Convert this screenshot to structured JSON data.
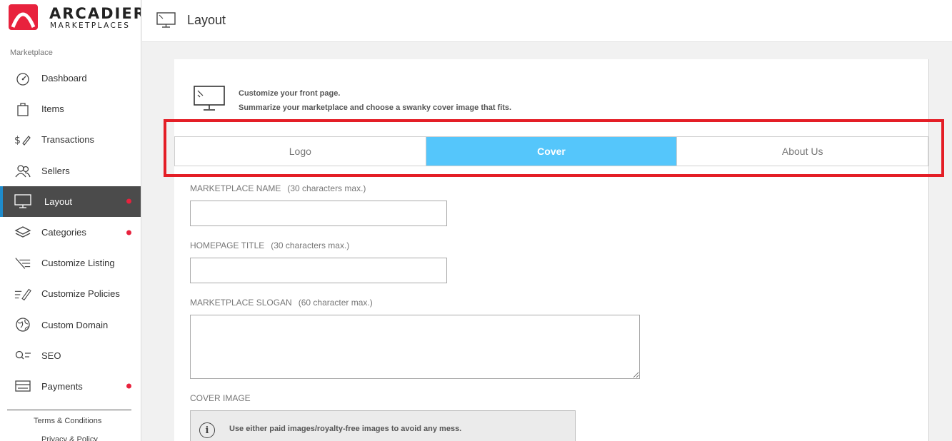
{
  "brand": {
    "name": "ARCADIER",
    "sub": "MARKETPLACES",
    "accent": "#e8223d"
  },
  "sidebar": {
    "section_label": "Marketplace",
    "items": [
      {
        "label": "Dashboard",
        "icon": "dashboard-icon",
        "active": false,
        "dot": false
      },
      {
        "label": "Items",
        "icon": "items-bag-icon",
        "active": false,
        "dot": false
      },
      {
        "label": "Transactions",
        "icon": "transactions-icon",
        "active": false,
        "dot": false
      },
      {
        "label": "Sellers",
        "icon": "sellers-icon",
        "active": false,
        "dot": false
      },
      {
        "label": "Layout",
        "icon": "monitor-icon",
        "active": true,
        "dot": true
      },
      {
        "label": "Categories",
        "icon": "layers-icon",
        "active": false,
        "dot": true
      },
      {
        "label": "Customize Listing",
        "icon": "customize-listing-icon",
        "active": false,
        "dot": false
      },
      {
        "label": "Customize Policies",
        "icon": "customize-policies-icon",
        "active": false,
        "dot": false
      },
      {
        "label": "Custom Domain",
        "icon": "globe-icon",
        "active": false,
        "dot": false
      },
      {
        "label": "SEO",
        "icon": "seo-icon",
        "active": false,
        "dot": false
      },
      {
        "label": "Payments",
        "icon": "payments-icon",
        "active": false,
        "dot": true
      }
    ],
    "footer_links": [
      "Terms & Conditions",
      "Privacy & Policy"
    ]
  },
  "header": {
    "title": "Layout",
    "icon": "monitor-icon"
  },
  "intro": {
    "line1": "Customize your front page.",
    "line2": "Summarize your marketplace and choose a swanky cover image that fits."
  },
  "tabs": [
    {
      "label": "Logo",
      "active": false
    },
    {
      "label": "Cover",
      "active": true
    },
    {
      "label": "About Us",
      "active": false
    }
  ],
  "form": {
    "marketplace_name": {
      "label": "MARKETPLACE NAME",
      "hint": "(30 characters max.)",
      "value": ""
    },
    "homepage_title": {
      "label": "HOMEPAGE TITLE",
      "hint": "(30 characters max.)",
      "value": ""
    },
    "marketplace_slogan": {
      "label": "MARKETPLACE SLOGAN",
      "hint": "(60 character max.)",
      "value": ""
    },
    "cover_image": {
      "label": "COVER IMAGE"
    }
  },
  "info_box": {
    "text": "Use either paid images/royalty-free images to avoid any mess."
  },
  "colors": {
    "active_tab": "#55c6fb",
    "active_nav": "#4b4b4b",
    "highlight": "#e41e26",
    "dot": "#e8223d"
  }
}
